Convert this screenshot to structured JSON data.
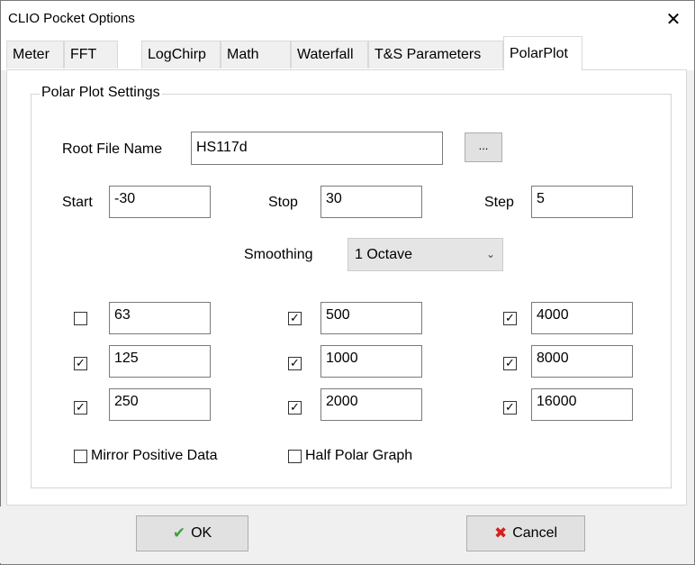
{
  "window": {
    "title": "CLIO Pocket Options",
    "close_glyph": "✕"
  },
  "tabs": [
    {
      "label": "Meter",
      "active": false
    },
    {
      "label": "FFT",
      "active": false
    },
    {
      "label": "LogChirp",
      "active": false
    },
    {
      "label": "Math",
      "active": false
    },
    {
      "label": "Waterfall",
      "active": false
    },
    {
      "label": "T&S Parameters",
      "active": false
    },
    {
      "label": "PolarPlot",
      "active": true
    }
  ],
  "group": {
    "title": "Polar Plot Settings"
  },
  "root_file": {
    "label": "Root File Name",
    "value": "HS117d",
    "browse_label": "..."
  },
  "range": {
    "start_label": "Start",
    "start_value": "-30",
    "stop_label": "Stop",
    "stop_value": "30",
    "step_label": "Step",
    "step_value": "5"
  },
  "smoothing": {
    "label": "Smoothing",
    "value": "1 Octave"
  },
  "frequencies": [
    {
      "value": "63",
      "checked": false
    },
    {
      "value": "125",
      "checked": true
    },
    {
      "value": "250",
      "checked": true
    },
    {
      "value": "500",
      "checked": true
    },
    {
      "value": "1000",
      "checked": true
    },
    {
      "value": "2000",
      "checked": true
    },
    {
      "value": "4000",
      "checked": true
    },
    {
      "value": "8000",
      "checked": true
    },
    {
      "value": "16000",
      "checked": true
    }
  ],
  "options": {
    "mirror_label": "Mirror Positive Data",
    "mirror_checked": false,
    "half_label": "Half Polar Graph",
    "half_checked": false
  },
  "buttons": {
    "ok_label": "OK",
    "cancel_label": "Cancel"
  },
  "icons": {
    "ok": "checkmark-icon",
    "cancel": "x-icon"
  },
  "colors": {
    "ok_icon": "#3aa33a",
    "cancel_icon": "#d42020"
  }
}
